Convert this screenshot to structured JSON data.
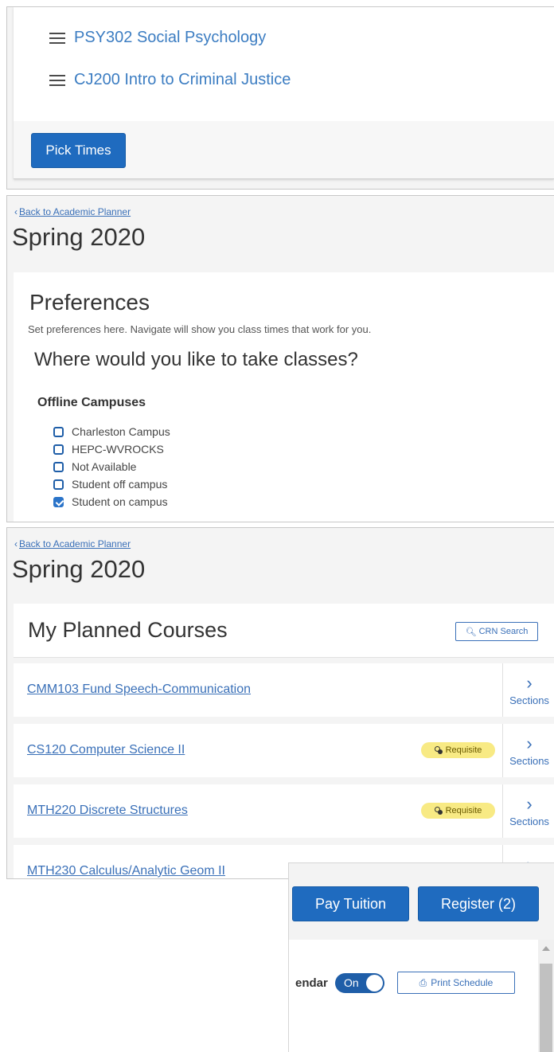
{
  "panel1": {
    "courses": [
      "PSY302 Social Psychology",
      "CJ200 Intro to Criminal Justice"
    ],
    "pick_times_label": "Pick Times"
  },
  "panel2": {
    "back_link": "Back to Academic Planner",
    "term": "Spring 2020",
    "preferences_title": "Preferences",
    "preferences_subtitle": "Set preferences here. Navigate will show you class times that work for you.",
    "where_question": "Where would you like to take classes?",
    "offline_heading": "Offline Campuses",
    "campuses": [
      {
        "label": "Charleston Campus",
        "checked": false
      },
      {
        "label": "HEPC-WVROCKS",
        "checked": false
      },
      {
        "label": "Not Available",
        "checked": false
      },
      {
        "label": "Student off campus",
        "checked": false
      },
      {
        "label": "Student on campus",
        "checked": true
      }
    ]
  },
  "panel3": {
    "back_link": "Back to Academic Planner",
    "term": "Spring 2020",
    "planned_title": "My Planned Courses",
    "crn_search_label": "CRN Search",
    "sections_label": "Sections",
    "requisite_label": "Requisite",
    "courses": [
      {
        "name": "CMM103 Fund Speech-Communication",
        "requisite": false
      },
      {
        "name": "CS120 Computer Science II",
        "requisite": true
      },
      {
        "name": "MTH220 Discrete Structures",
        "requisite": true
      },
      {
        "name": "MTH230 Calculus/Analytic Geom II",
        "requisite": true
      }
    ]
  },
  "panel4": {
    "pay_tuition_label": "Pay Tuition",
    "register_label": "Register (2)",
    "calendar_label_partial": "endar",
    "toggle_label": "On",
    "print_label": "Print Schedule"
  },
  "colors": {
    "primary_blue": "#1f6bbf",
    "link_blue": "#3a70b8",
    "requisite_yellow": "#f8ea84"
  }
}
